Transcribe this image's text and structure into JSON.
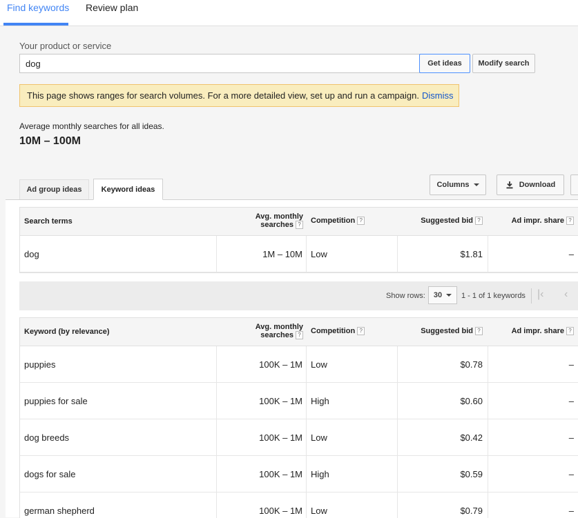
{
  "nav": {
    "tabs": [
      "Find keywords",
      "Review plan"
    ]
  },
  "search": {
    "label": "Your product or service",
    "value": "dog",
    "get_ideas": "Get ideas",
    "modify": "Modify search"
  },
  "notice": {
    "text": "This page shows ranges for search volumes. For a more detailed view, set up and run a campaign.",
    "dismiss": "Dismiss"
  },
  "summary": {
    "label": "Average monthly searches for all ideas.",
    "value": "10M – 100M"
  },
  "subtabs": [
    "Ad group ideas",
    "Keyword ideas"
  ],
  "toolbar": {
    "columns": "Columns",
    "download": "Download"
  },
  "headers": {
    "search_terms": "Search terms",
    "keyword": "Keyword (by relevance)",
    "avg_line1": "Avg. monthly",
    "avg_line2": "searches",
    "competition": "Competition",
    "bid": "Suggested bid",
    "impr": "Ad impr. share",
    "help": "?"
  },
  "search_terms": [
    {
      "term": "dog",
      "avg": "1M – 10M",
      "competition": "Low",
      "bid": "$1.81",
      "impr": "–"
    }
  ],
  "pager": {
    "label": "Show rows:",
    "rows": "30",
    "range": "1 - 1 of 1 keywords",
    "first": "|‹",
    "prev": "‹"
  },
  "keywords": [
    {
      "term": "puppies",
      "avg": "100K – 1M",
      "competition": "Low",
      "bid": "$0.78",
      "impr": "–"
    },
    {
      "term": "puppies for sale",
      "avg": "100K – 1M",
      "competition": "High",
      "bid": "$0.60",
      "impr": "–"
    },
    {
      "term": "dog breeds",
      "avg": "100K – 1M",
      "competition": "Low",
      "bid": "$0.42",
      "impr": "–"
    },
    {
      "term": "dogs for sale",
      "avg": "100K – 1M",
      "competition": "High",
      "bid": "$0.59",
      "impr": "–"
    },
    {
      "term": "german shepherd",
      "avg": "100K – 1M",
      "competition": "Low",
      "bid": "$0.79",
      "impr": "–"
    }
  ],
  "colors": {
    "accent": "#4285f4",
    "link": "#1155cc",
    "notice_bg": "#f9edbe"
  },
  "icons": {
    "download": "download-icon",
    "columns": "chevron-down-icon",
    "first_page": "first-page-icon",
    "prev_page": "prev-page-icon"
  }
}
